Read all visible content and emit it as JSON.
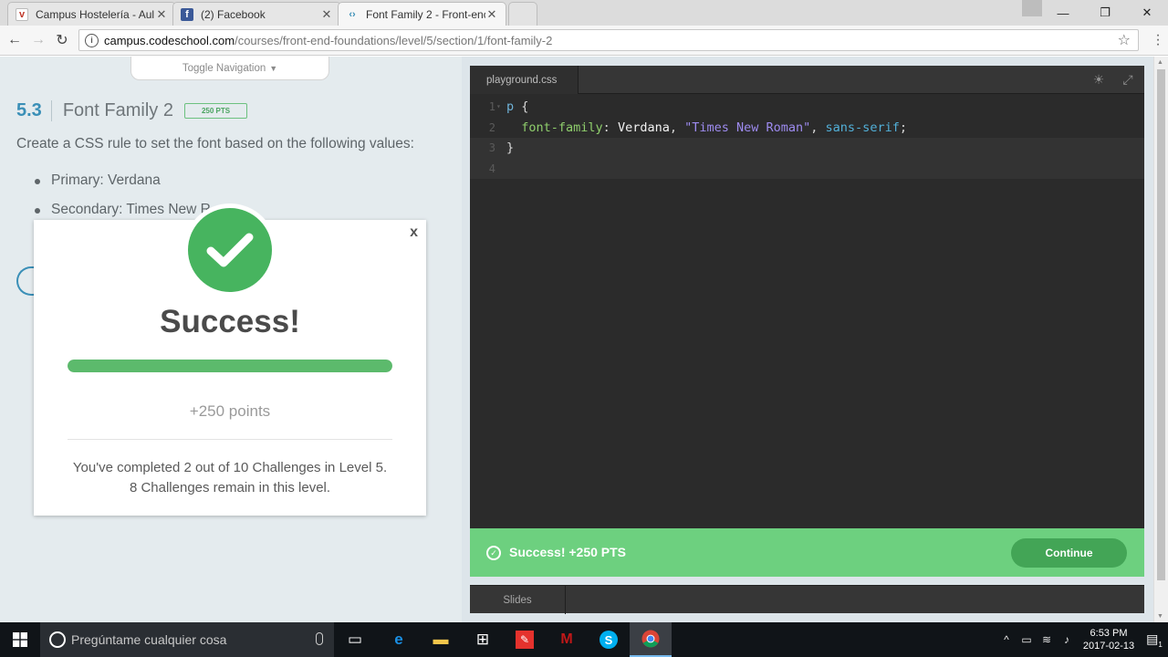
{
  "browser": {
    "tabs": [
      {
        "title": "Campus Hostelería - Aul",
        "icon": "v-check-icon",
        "color": "#c0392b"
      },
      {
        "title": "(2) Facebook",
        "icon": "facebook-icon",
        "color": "#3b5998"
      },
      {
        "title": "Font Family 2 - Front-enc",
        "icon": "code-brackets-icon",
        "color": "#3a8fb7"
      }
    ],
    "url_host": "campus.codeschool.com",
    "url_path": "/courses/front-end-foundations/level/5/section/1/font-family-2"
  },
  "nav": {
    "toggle_label": "Toggle Navigation"
  },
  "challenge": {
    "number": "5.3",
    "title": "Font Family 2",
    "points_badge": "250 PTS",
    "instructions": "Create a CSS rule to set the font based on the following values:",
    "bullets": [
      "Primary: Verdana",
      "Secondary: Times New R"
    ]
  },
  "modal": {
    "close_label": "x",
    "title": "Success!",
    "progress": 1.0,
    "points": "+250 points",
    "completed_line1": "You've completed 2 out of 10 Challenges in Level 5.",
    "completed_line2": "8 Challenges remain in this level."
  },
  "editor": {
    "file_tab": "playground.css",
    "lines": [
      {
        "num": "1",
        "tokens": [
          {
            "t": "p",
            "c": "tk-sel"
          },
          {
            "t": " {",
            "c": "tk-punc"
          }
        ]
      },
      {
        "num": "2",
        "tokens": [
          {
            "t": "  font-family",
            "c": "tk-prop"
          },
          {
            "t": ": ",
            "c": "tk-punc"
          },
          {
            "t": "Verdana",
            "c": "tk-plain"
          },
          {
            "t": ", ",
            "c": "tk-punc"
          },
          {
            "t": "\"Times New Roman\"",
            "c": "tk-str"
          },
          {
            "t": ", ",
            "c": "tk-punc"
          },
          {
            "t": "sans-serif",
            "c": "tk-kw"
          },
          {
            "t": ";",
            "c": "tk-punc"
          }
        ]
      },
      {
        "num": "3",
        "tokens": [
          {
            "t": "}",
            "c": "tk-punc"
          }
        ]
      },
      {
        "num": "4",
        "tokens": []
      }
    ],
    "success_message": "Success! +250 PTS",
    "continue_label": "Continue",
    "slides_tab": "Slides"
  },
  "taskbar": {
    "search_placeholder": "Pregúntame cualquier cosa",
    "time": "6:53 PM",
    "date": "2017-02-13",
    "notification_count": "1"
  },
  "colors": {
    "accent_blue": "#3a8fb7",
    "success_green": "#47b45f",
    "success_bar": "#6dd07f",
    "continue_button": "#43a556"
  }
}
